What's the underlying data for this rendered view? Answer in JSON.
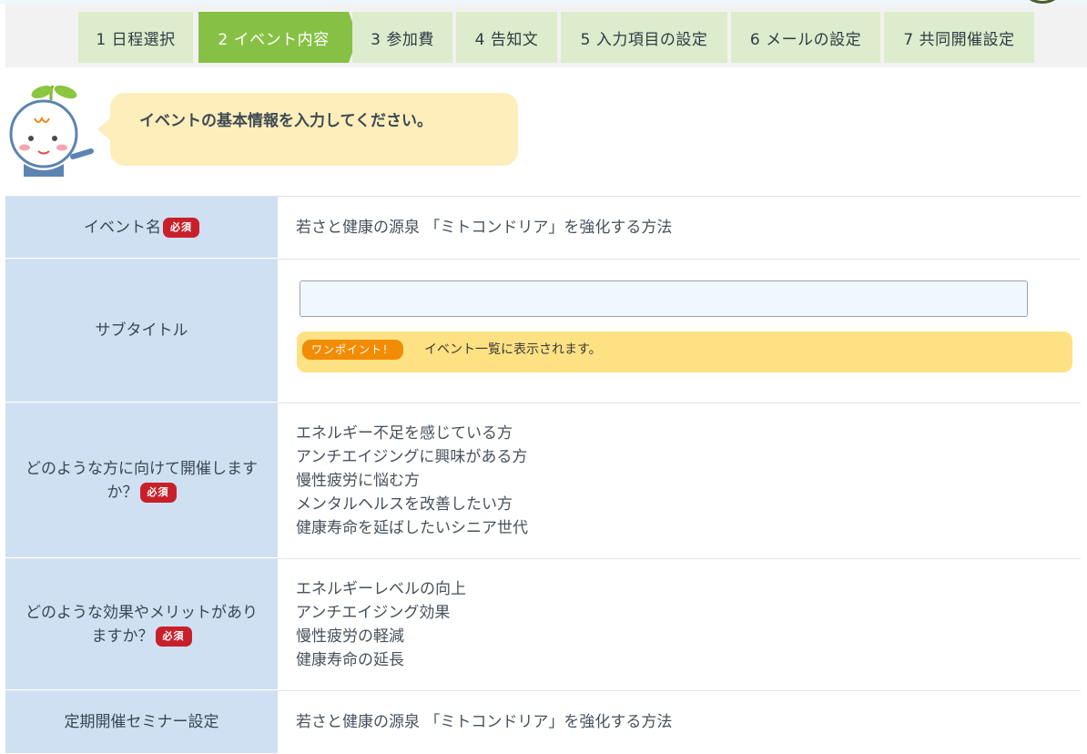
{
  "steps": [
    {
      "label": "1 日程選択",
      "active": false
    },
    {
      "label": "2 イベント内容",
      "active": true
    },
    {
      "label": "3 参加費",
      "active": false
    },
    {
      "label": "4 告知文",
      "active": false
    },
    {
      "label": "5 入力項目の設定",
      "active": false
    },
    {
      "label": "6 メールの設定",
      "active": false
    },
    {
      "label": "7 共同開催設定",
      "active": false
    }
  ],
  "bubble": {
    "text": "イベントの基本情報を入力してください。"
  },
  "required_badge": "必須",
  "form": {
    "event_name": {
      "label": "イベント名",
      "value": "若さと健康の源泉 「ミトコンドリア」を強化する方法"
    },
    "subtitle": {
      "label": "サブタイトル",
      "value": "",
      "tip_badge": "ワンポイント！",
      "tip_text": "イベント一覧に表示されます。"
    },
    "audience": {
      "label": "どのような方に向けて開催しますか？",
      "lines": [
        "エネルギー不足を感じている方",
        "アンチエイジングに興味がある方",
        "慢性疲労に悩む方",
        "メンタルヘルスを改善したい方",
        "健康寿命を延ばしたいシニア世代"
      ]
    },
    "benefits": {
      "label": "どのような効果やメリットがありますか？",
      "lines": [
        "エネルギーレベルの向上",
        "アンチエイジング効果",
        "慢性疲労の軽減",
        "健康寿命の延長"
      ]
    },
    "recurring": {
      "label": "定期開催セミナー設定",
      "value": "若さと健康の源泉 「ミトコンドリア」を強化する方法"
    }
  },
  "colors": {
    "step_active": "#86c145",
    "step_inactive": "#dceccc",
    "label_bg": "#cfe0f3",
    "required": "#c8202a",
    "bubble": "#fdeebc",
    "tip_bg": "#fde183",
    "tip_badge": "#f28c05"
  },
  "icons": {
    "mascot": "sprout-mascot-icon"
  }
}
